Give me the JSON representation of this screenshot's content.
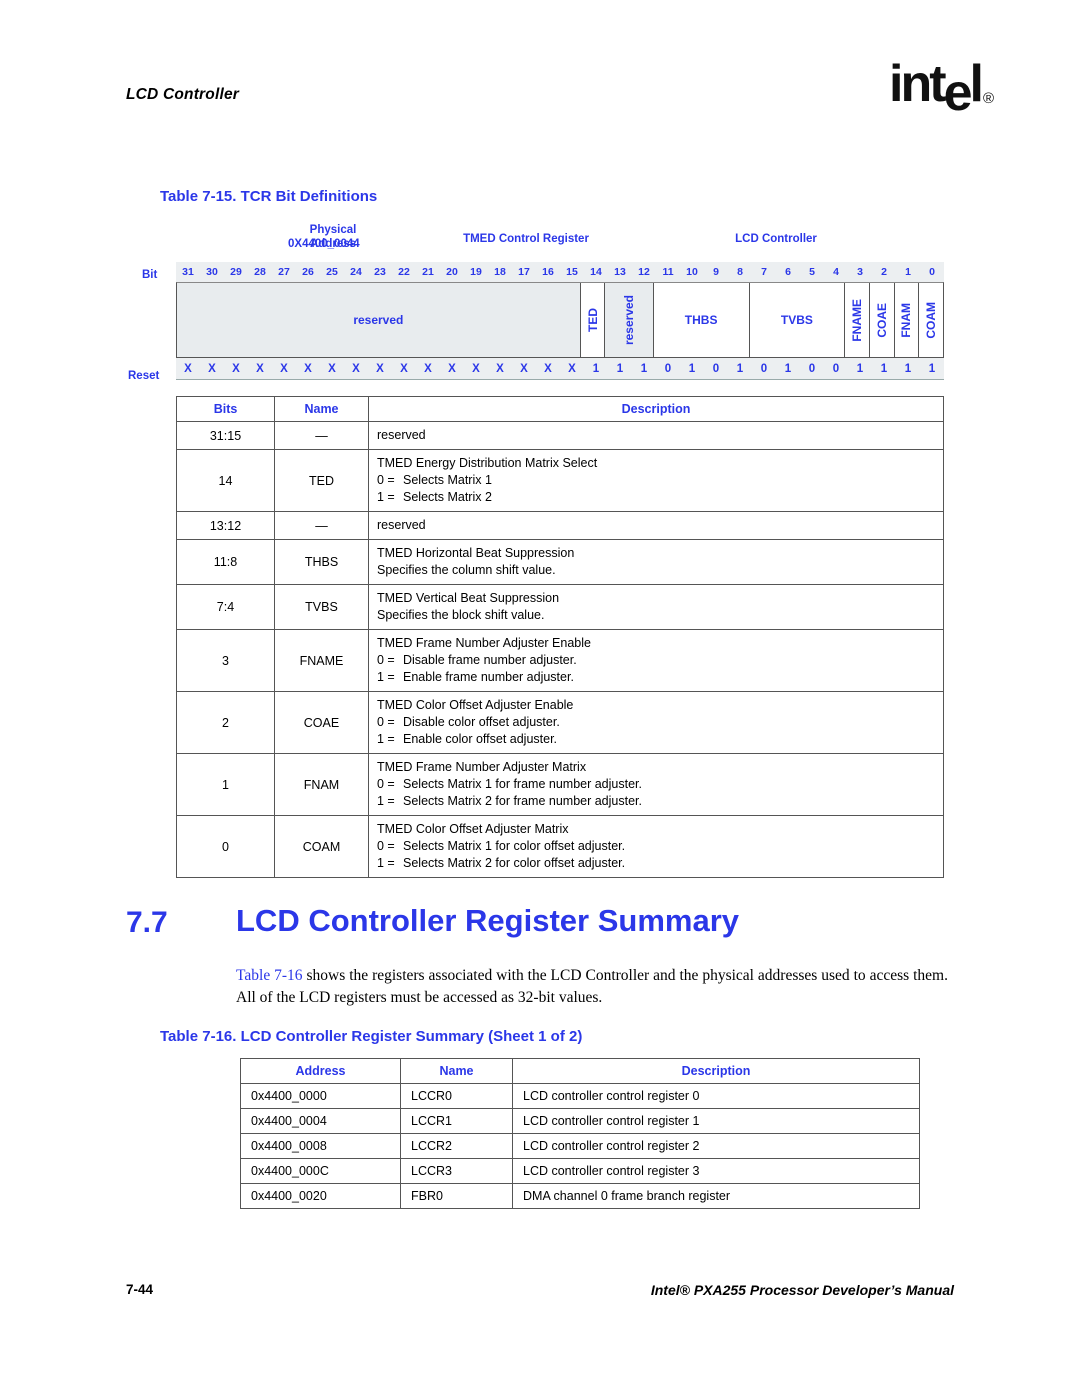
{
  "header": {
    "running_head": "LCD Controller",
    "logo_text": "intel",
    "logo_registered": "®"
  },
  "table_7_15": {
    "caption": "Table 7-15. TCR Bit Definitions",
    "labels": {
      "physical_address": "Physical Address\n0X4400_0044",
      "physical_address_line1": "Physical Address",
      "physical_address_line2": "0X4400_0044",
      "register_name": "TMED Control Register",
      "unit_name": "LCD Controller",
      "bit_label": "Bit",
      "reset_label": "Reset"
    },
    "bit_numbers": [
      "31",
      "30",
      "29",
      "28",
      "27",
      "26",
      "25",
      "24",
      "23",
      "22",
      "21",
      "20",
      "19",
      "18",
      "17",
      "16",
      "15",
      "14",
      "13",
      "12",
      "11",
      "10",
      "9",
      "8",
      "7",
      "6",
      "5",
      "4",
      "3",
      "2",
      "1",
      "0"
    ],
    "fields": [
      {
        "name": "reserved",
        "span": 17,
        "style": "reserved",
        "orient": "horizontal"
      },
      {
        "name": "TED",
        "span": 1,
        "style": "normal",
        "orient": "vertical"
      },
      {
        "name": "reserved",
        "span": 2,
        "style": "reserved",
        "orient": "vertical"
      },
      {
        "name": "THBS",
        "span": 4,
        "style": "normal",
        "orient": "horizontal"
      },
      {
        "name": "TVBS",
        "span": 4,
        "style": "normal",
        "orient": "horizontal"
      },
      {
        "name": "FNAME",
        "span": 1,
        "style": "normal",
        "orient": "vertical"
      },
      {
        "name": "COAE",
        "span": 1,
        "style": "normal",
        "orient": "vertical"
      },
      {
        "name": "FNAM",
        "span": 1,
        "style": "normal",
        "orient": "vertical"
      },
      {
        "name": "COAM",
        "span": 1,
        "style": "normal",
        "orient": "vertical"
      }
    ],
    "reset_values": [
      "X",
      "X",
      "X",
      "X",
      "X",
      "X",
      "X",
      "X",
      "X",
      "X",
      "X",
      "X",
      "X",
      "X",
      "X",
      "X",
      "X",
      "1",
      "1",
      "1",
      "0",
      "1",
      "0",
      "1",
      "0",
      "1",
      "0",
      "0",
      "1",
      "1",
      "1",
      "1"
    ],
    "columns": [
      "Bits",
      "Name",
      "Description"
    ],
    "rows": [
      {
        "bits": "31:15",
        "name": "—",
        "title": "reserved",
        "options": []
      },
      {
        "bits": "14",
        "name": "TED",
        "title": "TMED Energy Distribution Matrix Select",
        "options": [
          "0 =   Selects Matrix 1",
          "1 =   Selects Matrix 2"
        ]
      },
      {
        "bits": "13:12",
        "name": "—",
        "title": "reserved",
        "options": []
      },
      {
        "bits": "11:8",
        "name": "THBS",
        "title": "TMED Horizontal Beat Suppression",
        "options": [
          "Specifies the column shift value."
        ]
      },
      {
        "bits": "7:4",
        "name": "TVBS",
        "title": "TMED Vertical Beat Suppression",
        "options": [
          "Specifies the block shift value."
        ]
      },
      {
        "bits": "3",
        "name": "FNAME",
        "title": "TMED Frame Number Adjuster Enable",
        "options": [
          "0 =   Disable frame number adjuster.",
          "1 =   Enable frame number adjuster."
        ]
      },
      {
        "bits": "2",
        "name": "COAE",
        "title": "TMED Color Offset Adjuster Enable",
        "options": [
          "0 =   Disable color offset adjuster.",
          "1 =   Enable color offset adjuster."
        ]
      },
      {
        "bits": "1",
        "name": "FNAM",
        "title": "TMED Frame Number Adjuster Matrix",
        "options": [
          "0 =   Selects Matrix 1 for frame number adjuster.",
          "1 =   Selects Matrix 2 for frame number adjuster."
        ]
      },
      {
        "bits": "0",
        "name": "COAM",
        "title": "TMED Color Offset Adjuster Matrix",
        "options": [
          "0 =   Selects Matrix 1 for color offset adjuster.",
          "1 =   Selects Matrix 2 for color offset adjuster."
        ]
      }
    ]
  },
  "section": {
    "number": "7.7",
    "title": "LCD Controller Register Summary",
    "paragraph_xref": "Table 7-16",
    "paragraph_rest": " shows the registers associated with the LCD Controller and the physical addresses used to access them. All of the LCD registers must be accessed as 32-bit values."
  },
  "table_7_16": {
    "caption": "Table 7-16. LCD Controller Register Summary (Sheet 1 of 2)",
    "columns": [
      "Address",
      "Name",
      "Description"
    ],
    "rows": [
      {
        "address": "0x4400_0000",
        "name": "LCCR0",
        "description": "LCD controller control register 0"
      },
      {
        "address": "0x4400_0004",
        "name": "LCCR1",
        "description": "LCD controller control register 1"
      },
      {
        "address": "0x4400_0008",
        "name": "LCCR2",
        "description": "LCD controller control register 2"
      },
      {
        "address": "0x4400_000C",
        "name": "LCCR3",
        "description": "LCD controller control register 3"
      },
      {
        "address": "0x4400_0020",
        "name": "FBR0",
        "description": "DMA channel 0 frame branch register"
      }
    ]
  },
  "footer": {
    "page_number": "7-44",
    "manual_title": "Intel® PXA255 Processor Developer’s Manual"
  },
  "colors": {
    "accent_blue": "#2B37E8",
    "reserved_fill": "#E8ECEE",
    "strip_fill": "#ECEFF1"
  }
}
